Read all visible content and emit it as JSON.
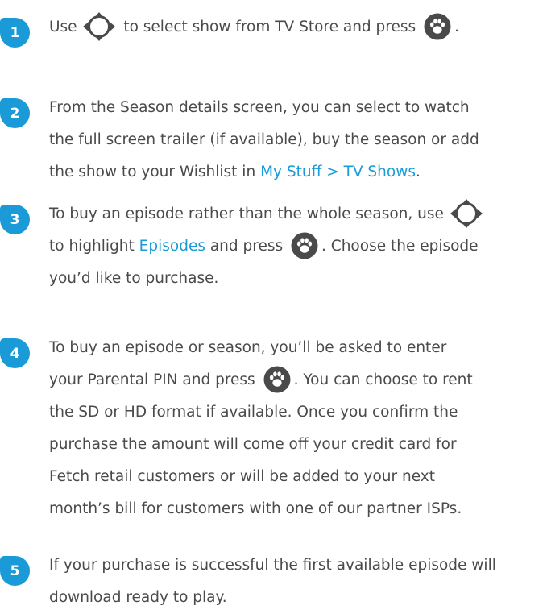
{
  "steps": [
    {
      "number": "1",
      "lines": [
        [
          "Use ",
          {
            "icon": "dpad"
          },
          " to select show from TV Store and press ",
          {
            "icon": "ok"
          },
          "."
        ]
      ]
    },
    {
      "number": "2",
      "lines": [
        [
          "From the Season details screen, you can select to watch"
        ],
        [
          "the full screen trailer (if available), buy the season or add"
        ],
        [
          "the show to your Wishlist in ",
          {
            "link": "My Stuff > TV Shows"
          },
          "."
        ]
      ]
    },
    {
      "number": "3",
      "lines": [
        [
          "To buy an episode rather than the whole season, use ",
          {
            "icon": "dpad"
          }
        ],
        [
          "to highlight ",
          {
            "link": "Episodes"
          },
          " and press ",
          {
            "icon": "ok"
          },
          ". Choose the episode"
        ],
        [
          "you’d like to purchase."
        ]
      ]
    },
    {
      "number": "4",
      "lines": [
        [
          "To buy an episode or season, you’ll be asked to enter"
        ],
        [
          "your Parental PIN and press ",
          {
            "icon": "ok"
          },
          ". You can choose to rent"
        ],
        [
          "the SD or HD format if available. Once you confirm the"
        ],
        [
          "purchase the amount will come off your credit card for"
        ],
        [
          "Fetch retail customers or will be added to your next"
        ],
        [
          "month’s bill for customers with one of our partner ISPs."
        ]
      ]
    },
    {
      "number": "5",
      "lines": [
        [
          "If your purchase is successful the first available episode will"
        ],
        [
          "download ready to play."
        ]
      ]
    }
  ],
  "colors": {
    "accent": "#1a9bd7",
    "text": "#4a4a4a"
  },
  "icons": {
    "dpad": "dpad-navigation-icon",
    "ok": "paw-ok-button-icon"
  }
}
